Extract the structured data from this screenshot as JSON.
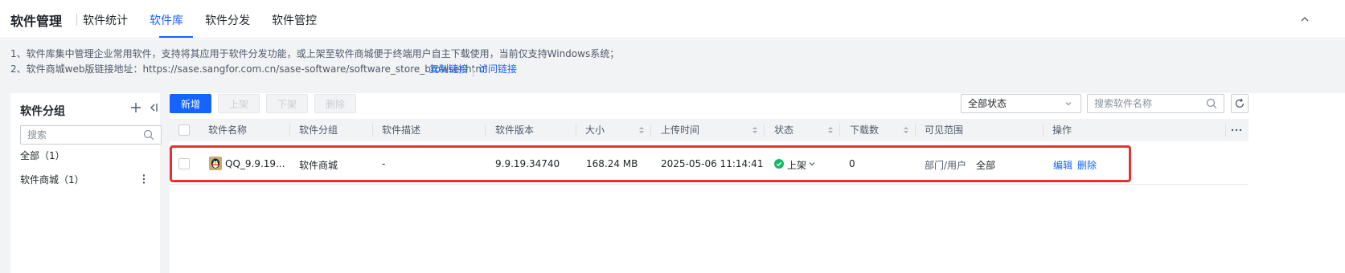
{
  "header": {
    "title": "软件管理",
    "tabs": [
      {
        "label": "软件统计",
        "active": false
      },
      {
        "label": "软件库",
        "active": true
      },
      {
        "label": "软件分发",
        "active": false
      },
      {
        "label": "软件管控",
        "active": false
      }
    ],
    "collapse_icon": "chevron-up-icon"
  },
  "notice": {
    "line1": "1、软件库集中管理企业常用软件，支持将其应用于软件分发功能，或上架至软件商城便于终端用户自主下载使用，当前仅支持Windows系统；",
    "line2": "2、软件商城web版链接地址：https://sase.sangfor.com.cn/sase-software/software_store_browser.html",
    "copy_link": "复制链接",
    "visit_link": "访问链接"
  },
  "sidebar": {
    "title": "软件分组",
    "add_icon": "plus-icon",
    "collapse_icon": "collapse-left-icon",
    "search_placeholder": "搜索",
    "items": [
      {
        "label": "全部（1）"
      },
      {
        "label": "软件商城（1）"
      }
    ]
  },
  "toolbar": {
    "add": "新增",
    "publish": "上架",
    "unpublish": "下架",
    "delete": "删除",
    "status_filter": "全部状态",
    "search_placeholder": "搜索软件名称",
    "refresh_icon": "refresh-icon"
  },
  "table": {
    "columns": [
      "软件名称",
      "软件分组",
      "软件描述",
      "软件版本",
      "大小",
      "上传时间",
      "状态",
      "下载数",
      "可见范围",
      "操作"
    ],
    "rows": [
      {
        "name": "QQ_9.9.19...",
        "group": "软件商城",
        "description": "-",
        "version": "9.9.19.34740",
        "size": "168.24 MB",
        "upload_time": "2025-05-06 11:14:41",
        "status": "上架",
        "downloads": "0",
        "scope_label": "部门/用户",
        "scope_value": "全部",
        "actions": [
          "编辑",
          "删除"
        ]
      }
    ]
  },
  "colors": {
    "primary": "#1664ff",
    "highlight": "#e8312f",
    "status_on": "#14b865"
  }
}
